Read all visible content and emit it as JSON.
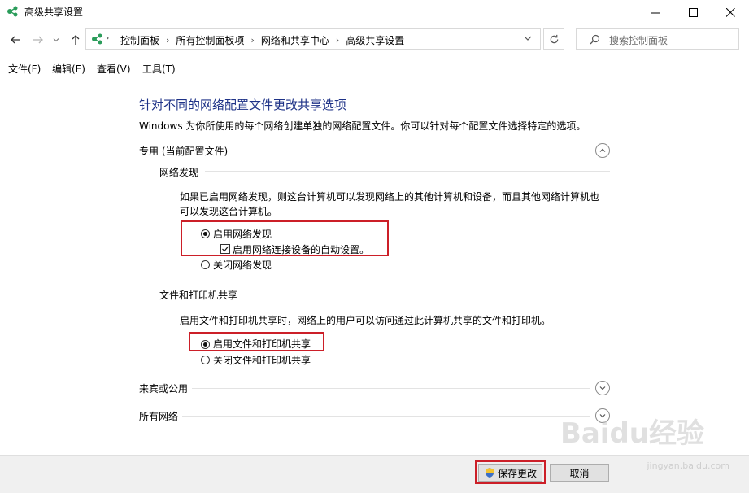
{
  "window": {
    "title": "高级共享设置",
    "controls": {
      "minimize": "—",
      "maximize": "☐",
      "close": "✕"
    }
  },
  "navigation": {
    "breadcrumbs": [
      "控制面板",
      "所有控制面板项",
      "网络和共享中心",
      "高级共享设置"
    ],
    "search_placeholder": "搜索控制面板"
  },
  "menubar": [
    "文件(F)",
    "编辑(E)",
    "查看(V)",
    "工具(T)"
  ],
  "main": {
    "heading": "针对不同的网络配置文件更改共享选项",
    "description": "Windows 为你所使用的每个网络创建单独的网络配置文件。你可以针对每个配置文件选择特定的选项。",
    "profiles": [
      {
        "title": "专用 (当前配置文件)",
        "expanded": true
      },
      {
        "title": "来宾或公用",
        "expanded": false
      },
      {
        "title": "所有网络",
        "expanded": false
      }
    ],
    "network_discovery": {
      "title": "网络发现",
      "description_line1": "如果已启用网络发现，则这台计算机可以发现网络上的其他计算机和设备，而且其他网络计算机也",
      "description_line2": "可以发现这台计算机。",
      "option_on": "启用网络发现",
      "auto_setup": "启用网络连接设备的自动设置。",
      "option_off": "关闭网络发现",
      "selected": "on",
      "auto_setup_checked": true
    },
    "file_printer_sharing": {
      "title": "文件和打印机共享",
      "description": "启用文件和打印机共享时，网络上的用户可以访问通过此计算机共享的文件和打印机。",
      "option_on": "启用文件和打印机共享",
      "option_off": "关闭文件和打印机共享",
      "selected": "on"
    }
  },
  "footer": {
    "save_label": "保存更改",
    "cancel_label": "取消"
  },
  "watermark": {
    "logo": "Baidu经验",
    "url": "jingyan.baidu.com"
  },
  "colors": {
    "heading": "#1e3287",
    "highlight": "#cc1f28",
    "footer_bg": "#f0f0f0"
  }
}
